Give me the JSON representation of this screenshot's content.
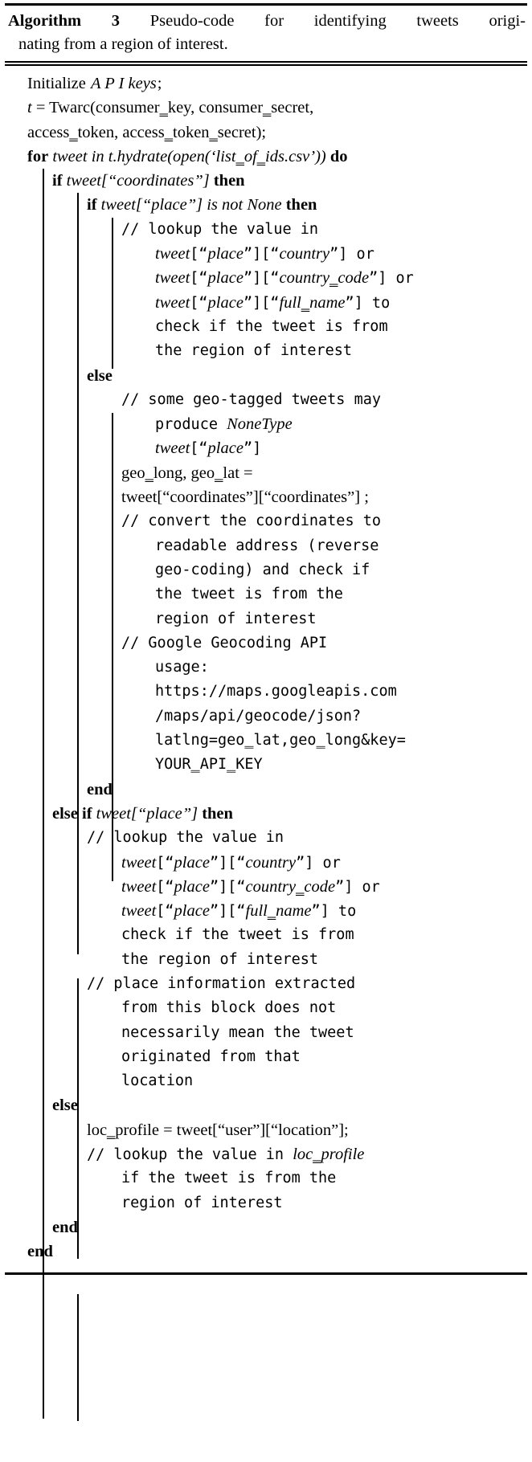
{
  "caption": {
    "label": "Algorithm 3",
    "text": "Pseudo-code for identifying tweets origi-",
    "text_line2": "nating from a region of interest."
  },
  "keywords": {
    "for": "for",
    "do": "do",
    "if": "if",
    "then": "then",
    "else": "else",
    "else_if": "else if",
    "end": "end"
  },
  "lines": [
    {
      "n": 1,
      "indent": 0,
      "kind": "stmt",
      "text": "Initialize APIkeys;"
    },
    {
      "n": 2,
      "indent": 0,
      "kind": "stmt",
      "text": "t = Twarc(consumer_key, consumer_secret,"
    },
    {
      "n": 3,
      "indent": 0,
      "kind": "stmt",
      "text": "access_token, access_token_secret);"
    },
    {
      "n": 4,
      "indent": 0,
      "kind": "for",
      "text": "for tweet in t.hydrate(open('list_of_ids.csv')) do"
    },
    {
      "n": 5,
      "indent": 1,
      "kind": "if",
      "text": "if tweet[“coordinates”] then"
    },
    {
      "n": 6,
      "indent": 2,
      "kind": "if",
      "text": "if tweet[“place”] is not None then"
    },
    {
      "n": 7,
      "indent": 3,
      "kind": "comment",
      "text": "// lookup the value in tweet[“place”][“country”] or tweet[“place”][“country_code”] or tweet[“place”][“full_name”] to check if the tweet is from the region of interest"
    },
    {
      "n": 8,
      "indent": 2,
      "kind": "else",
      "text": "else"
    },
    {
      "n": 9,
      "indent": 3,
      "kind": "comment",
      "text": "// some geo-tagged tweets may produce NoneType tweet[“place”]"
    },
    {
      "n": 10,
      "indent": 3,
      "kind": "stmt",
      "text": "geo_long, geo_lat = tweet[“coordinates”][“coordinates”];"
    },
    {
      "n": 11,
      "indent": 3,
      "kind": "comment",
      "text": "// convert the coordinates to readable address (reverse geo-coding) and check if the tweet is from the region of interest"
    },
    {
      "n": 12,
      "indent": 3,
      "kind": "comment",
      "text": "// Google Geocoding API usage: https://maps.googleapis.com/maps/api/geocode/json?latlng=geo_lat,geo_long&key=YOUR_API_KEY"
    },
    {
      "n": 13,
      "indent": 2,
      "kind": "end",
      "text": "end"
    },
    {
      "n": 14,
      "indent": 1,
      "kind": "elseif",
      "text": "else if tweet[“place”] then"
    },
    {
      "n": 15,
      "indent": 2,
      "kind": "comment",
      "text": "// lookup the value in tweet[“place”][“country”] or tweet[“place”][“country_code”] or tweet[“place”][“full_name”] to check if the tweet is from the region of interest"
    },
    {
      "n": 16,
      "indent": 2,
      "kind": "comment",
      "text": "// place information extracted from this block does not necessarily mean the tweet originated from that location"
    },
    {
      "n": 17,
      "indent": 1,
      "kind": "else",
      "text": "else"
    },
    {
      "n": 18,
      "indent": 2,
      "kind": "stmt",
      "text": "loc_profile = tweet[“user”][“location”];"
    },
    {
      "n": 19,
      "indent": 2,
      "kind": "comment",
      "text": "// lookup the value in loc_profile if the tweet is from the region of interest"
    },
    {
      "n": 20,
      "indent": 1,
      "kind": "end",
      "text": "end"
    },
    {
      "n": 21,
      "indent": 0,
      "kind": "end",
      "text": "end"
    }
  ],
  "rendered_lines": [
    "Initialize APIkeys;",
    "t = Twarc(consumer_key, consumer_secret,",
    "access_token, access_token_secret);",
    "for tweet in t.hydrate(open(‘list_of_ids.csv’)) do",
    "if tweet[“coordinates”] then",
    "if tweet[“place”] is not None then",
    "// lookup the value in",
    "tweet[“place”][“country”] or",
    "tweet[“place”][“country_code”] or",
    "tweet[“place”][“full_name”] to",
    "check if the tweet is from",
    "the region of interest",
    "else",
    "// some geo-tagged tweets may",
    "produce NoneType",
    "tweet[“place”]",
    "geo_long, geo_lat =",
    "tweet[“coordinates”][“coordinates”];",
    "// convert the coordinates to",
    "readable address (reverse",
    "geo-coding) and check if",
    "the tweet is from the",
    "region of interest",
    "// Google Geocoding API",
    "usage:",
    "https://maps.googleapis.com",
    "/maps/api/geocode/json?",
    "latlng=geo_lat,geo_long&key=",
    "YOUR_API_KEY",
    "end",
    "else if tweet[“place”] then",
    "// lookup the value in",
    "tweet[“place”][“country”] or",
    "tweet[“place”][“country_code”] or",
    "tweet[“place”][“full_name”] to",
    "check if the tweet is from",
    "the region of interest",
    "// place information extracted",
    "from this block does not",
    "necessarily mean the tweet",
    "originated from that",
    "location",
    "else",
    "loc_profile = tweet[“user”][“location”];",
    "// lookup the value in loc_profile",
    "if the tweet is from the",
    "region of interest",
    "end",
    "end"
  ],
  "colors": {
    "ink": "#000000",
    "paper": "#ffffff"
  }
}
